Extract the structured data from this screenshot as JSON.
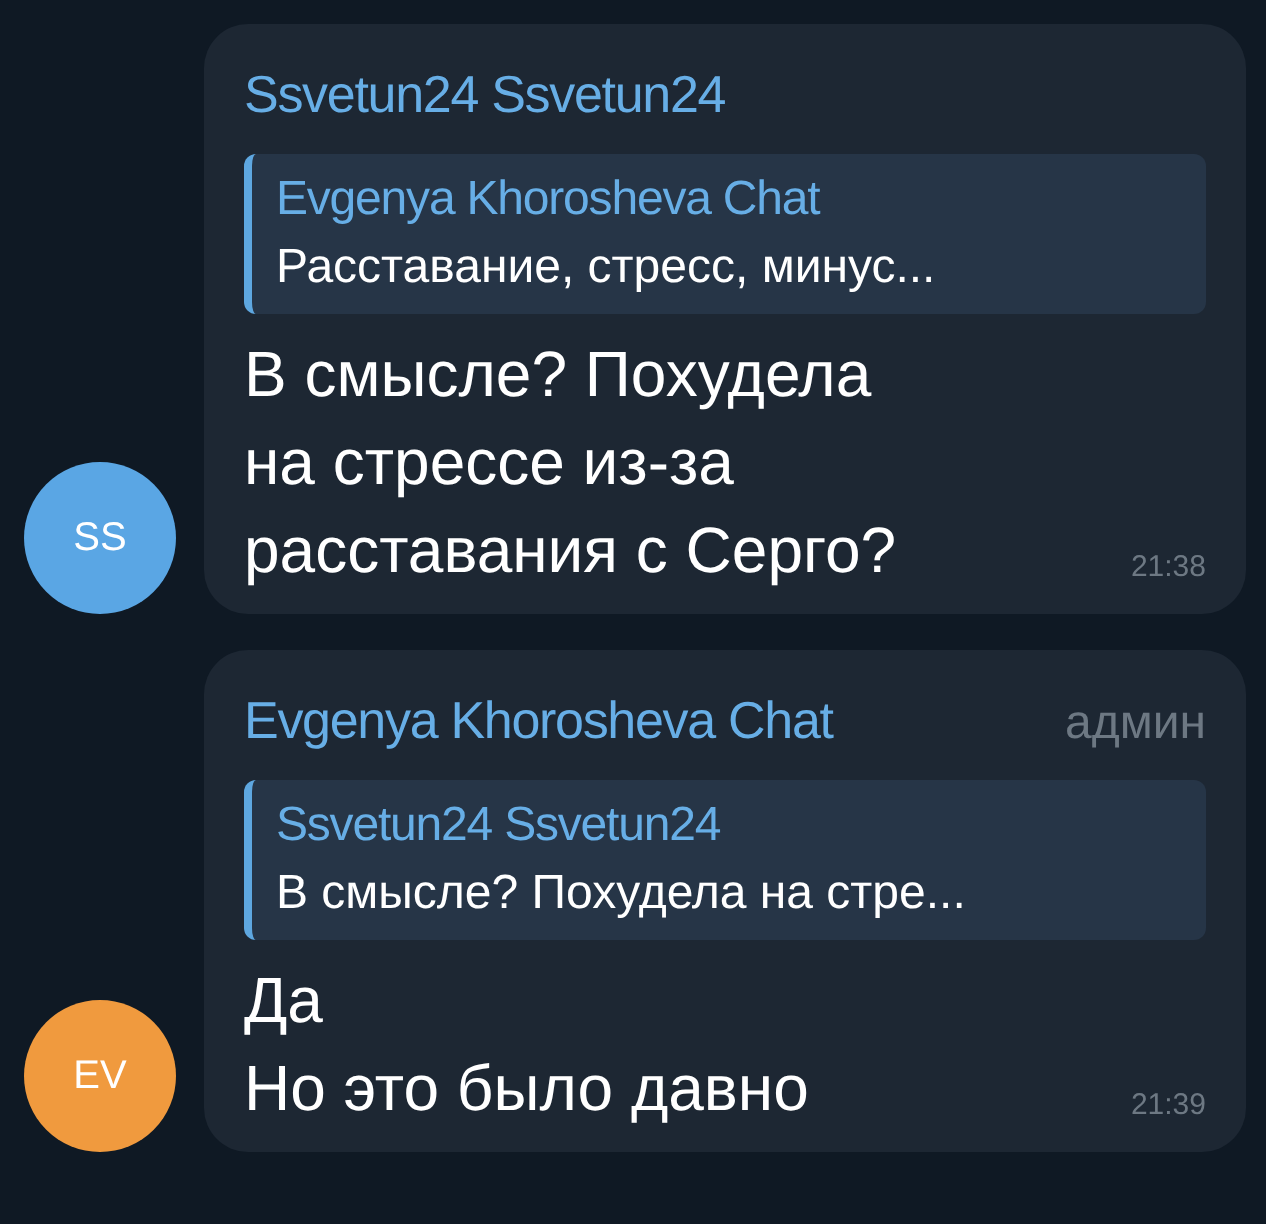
{
  "messages": [
    {
      "sender": "Ssvetun24 Ssvetun24",
      "avatar": {
        "initials": "SS",
        "color": "#5aa6e4"
      },
      "reply": {
        "author": "Evgenya Khorosheva Chat",
        "text": "Расставание, стресс, минус..."
      },
      "text": "В смысле? Похудела\nна стрессе из-за\nрасставания с Серго?",
      "time": "21:38"
    },
    {
      "sender": "Evgenya Khorosheva Chat",
      "badge": "админ",
      "avatar": {
        "initials": "EV",
        "color": "#f09a3e"
      },
      "reply": {
        "author": "Ssvetun24 Ssvetun24",
        "text": "В смысле? Похудела на стре..."
      },
      "text": "Да\nНо это было давно",
      "time": "21:39"
    }
  ]
}
